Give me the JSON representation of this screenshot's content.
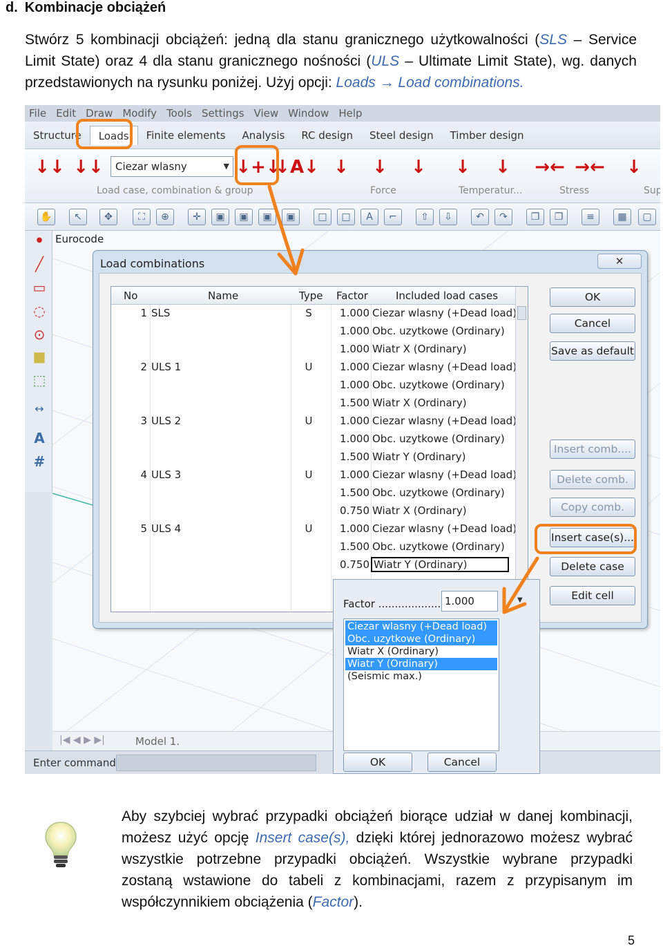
{
  "section": {
    "letter": "d.",
    "title": "Kombinacje obciążeń"
  },
  "intro": {
    "part1": "Stwórz 5 kombinacji obciążeń: jedną dla stanu granicznego użytkowalności (",
    "sls": "SLS",
    "part2": " – Service Limit State) oraz 4 dla stanu granicznego nośności (",
    "uls": "ULS",
    "part3": " – Ultimate Limit State), wg. danych przedstawionych na rysunku poniżej. Użyj opcji: ",
    "option": "Loads → Load combinations."
  },
  "app": {
    "menu": [
      "File",
      "Edit",
      "Draw",
      "Modify",
      "Tools",
      "Settings",
      "View",
      "Window",
      "Help"
    ],
    "tabs": [
      "Structure",
      "Loads",
      "Finite elements",
      "Analysis",
      "RC design",
      "Steel design",
      "Timber design"
    ],
    "active_tab": "Loads",
    "load_case_combo": "Ciezar wlasny",
    "ribbon_groups": [
      "Load case, combination & group",
      "Force",
      "Temperatur...",
      "Stress",
      "Sup"
    ],
    "canvas_label": "Eurocode",
    "model_tab": "Model 1.",
    "command_label": "Enter command :",
    "highlight_color": "#f0811f"
  },
  "dialog": {
    "title": "Load combinations",
    "columns": [
      "No",
      "Name",
      "Type",
      "Factor",
      "Included load cases"
    ],
    "rows": [
      {
        "no": "1",
        "name": "SLS",
        "type": "S",
        "factor": "1.000",
        "case": "Ciezar wlasny (+Dead load)"
      },
      {
        "no": "",
        "name": "",
        "type": "",
        "factor": "1.000",
        "case": "Obc. uzytkowe (Ordinary)"
      },
      {
        "no": "",
        "name": "",
        "type": "",
        "factor": "1.000",
        "case": "Wiatr X (Ordinary)"
      },
      {
        "no": "2",
        "name": "ULS 1",
        "type": "U",
        "factor": "1.000",
        "case": "Ciezar wlasny (+Dead load)"
      },
      {
        "no": "",
        "name": "",
        "type": "",
        "factor": "1.000",
        "case": "Obc. uzytkowe (Ordinary)"
      },
      {
        "no": "",
        "name": "",
        "type": "",
        "factor": "1.500",
        "case": "Wiatr X (Ordinary)"
      },
      {
        "no": "3",
        "name": "ULS 2",
        "type": "U",
        "factor": "1.000",
        "case": "Ciezar wlasny (+Dead load)"
      },
      {
        "no": "",
        "name": "",
        "type": "",
        "factor": "1.000",
        "case": "Obc. uzytkowe (Ordinary)"
      },
      {
        "no": "",
        "name": "",
        "type": "",
        "factor": "1.500",
        "case": "Wiatr Y (Ordinary)"
      },
      {
        "no": "4",
        "name": "ULS 3",
        "type": "U",
        "factor": "1.000",
        "case": "Ciezar wlasny (+Dead load)"
      },
      {
        "no": "",
        "name": "",
        "type": "",
        "factor": "1.500",
        "case": "Obc. uzytkowe (Ordinary)"
      },
      {
        "no": "",
        "name": "",
        "type": "",
        "factor": "0.750",
        "case": "Wiatr X (Ordinary)"
      },
      {
        "no": "5",
        "name": "ULS 4",
        "type": "U",
        "factor": "1.000",
        "case": "Ciezar wlasny (+Dead load)"
      },
      {
        "no": "",
        "name": "",
        "type": "",
        "factor": "1.500",
        "case": "Obc. uzytkowe (Ordinary)"
      },
      {
        "no": "",
        "name": "",
        "type": "",
        "factor": "0.750",
        "case": "Wiatr Y (Ordinary)"
      }
    ],
    "buttons": {
      "ok": "OK",
      "cancel": "Cancel",
      "save_default": "Save as default",
      "insert_comb": "Insert comb....",
      "delete_comb": "Delete comb.",
      "copy_comb": "Copy comb.",
      "insert_cases": "Insert case(s)...",
      "delete_case": "Delete case",
      "edit_cell": "Edit cell"
    }
  },
  "popup": {
    "factor_label": "Factor .......................",
    "factor_value": "1.000",
    "items": [
      {
        "label": "Ciezar wlasny (+Dead load)",
        "selected": true
      },
      {
        "label": "Obc. uzytkowe (Ordinary)",
        "selected": true
      },
      {
        "label": "Wiatr X (Ordinary)",
        "selected": false
      },
      {
        "label": "Wiatr Y (Ordinary)",
        "selected": true
      },
      {
        "label": "(Seismic max.)",
        "selected": false
      }
    ],
    "ok": "OK",
    "cancel": "Cancel"
  },
  "tip": {
    "part1": "Aby szybciej wybrać przypadki obciążeń biorące udział w danej kombinacji, możesz użyć opcję ",
    "option": "Insert case(s),",
    "part2": " dzięki której jednorazowo możesz wybrać wszystkie potrzebne przypadki obciążeń. Wszystkie wybrane przypadki zostaną wstawione do tabeli z kombinacjami, razem z przypisanym im współczynnikiem obciążenia (",
    "factor": "Factor",
    "part3": ")."
  },
  "page_number": "5"
}
